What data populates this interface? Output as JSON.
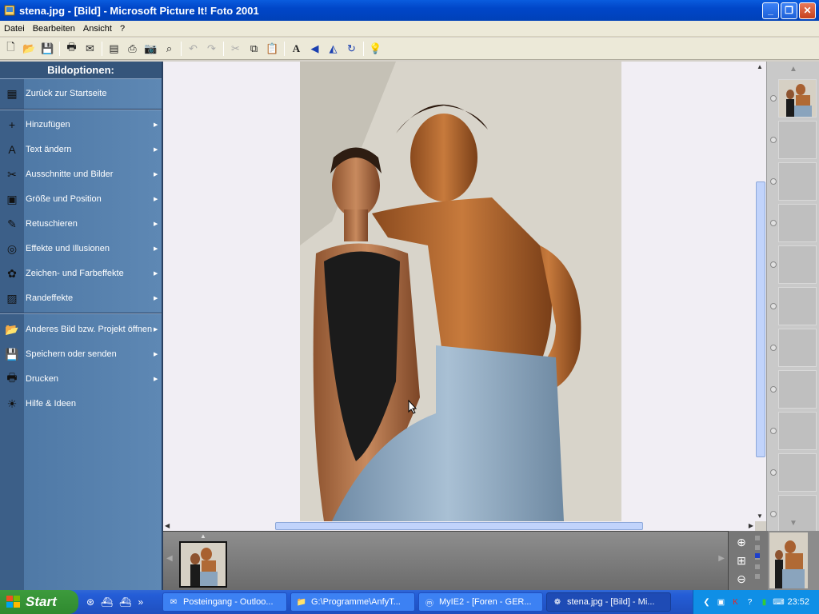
{
  "window": {
    "title": "stena.jpg - [Bild] - Microsoft Picture It! Foto 2001",
    "minimize_label": "_",
    "restore_label": "❐",
    "close_label": "✕"
  },
  "menubar": {
    "items": [
      "Datei",
      "Bearbeiten",
      "Ansicht",
      "?"
    ]
  },
  "toolbar": {
    "icons": [
      "new-icon",
      "open-icon",
      "save-icon",
      "print-icon",
      "mail-icon",
      "photo-icon",
      "scanner-icon",
      "camera-icon",
      "acquire-icon",
      "undo-icon",
      "redo-icon",
      "cut-icon",
      "copy-icon",
      "paste-icon",
      "text-icon",
      "rotate-icon",
      "flip-icon",
      "refresh-icon",
      "idea-icon"
    ]
  },
  "sidebar": {
    "header": "Bildoptionen:",
    "items": [
      {
        "label": "Zurück zur Startseite",
        "icon": "home-icon",
        "arrow": false
      },
      {
        "label": "Hinzufügen",
        "icon": "plus-icon",
        "arrow": true
      },
      {
        "label": "Text ändern",
        "icon": "text-icon",
        "arrow": true
      },
      {
        "label": "Ausschnitte und Bilder",
        "icon": "scissors-icon",
        "arrow": true
      },
      {
        "label": "Größe und Position",
        "icon": "resize-icon",
        "arrow": true
      },
      {
        "label": "Retuschieren",
        "icon": "retouch-icon",
        "arrow": true
      },
      {
        "label": "Effekte und Illusionen",
        "icon": "effects-icon",
        "arrow": true
      },
      {
        "label": "Zeichen- und Farbeffekte",
        "icon": "palette-icon",
        "arrow": true
      },
      {
        "label": "Randeffekte",
        "icon": "edge-icon",
        "arrow": true
      },
      {
        "label": "Anderes Bild bzw. Projekt öffnen",
        "icon": "open-folder-icon",
        "arrow": true
      },
      {
        "label": "Speichern oder senden",
        "icon": "save-icon",
        "arrow": true
      },
      {
        "label": "Drucken",
        "icon": "printer-icon",
        "arrow": true
      },
      {
        "label": "Hilfe & Ideen",
        "icon": "help-bulb-icon",
        "arrow": false
      }
    ]
  },
  "taskbar": {
    "start_label": "Start",
    "tasks": [
      {
        "label": "Posteingang - Outloo...",
        "icon": "outlook-icon",
        "active": false
      },
      {
        "label": "G:\\Programme\\AnfyT...",
        "icon": "folder-icon",
        "active": false
      },
      {
        "label": "MyIE2 - [Foren - GER...",
        "icon": "browser-icon",
        "active": false
      },
      {
        "label": "stena.jpg - [Bild] - Mi...",
        "icon": "pictureit-icon",
        "active": true
      }
    ],
    "clock": "23:52"
  },
  "colors": {
    "titlebar": "#0046c8",
    "sidebar": "#4f79a6",
    "canvas": "#f1eef4",
    "taskbar": "#245dd7"
  }
}
